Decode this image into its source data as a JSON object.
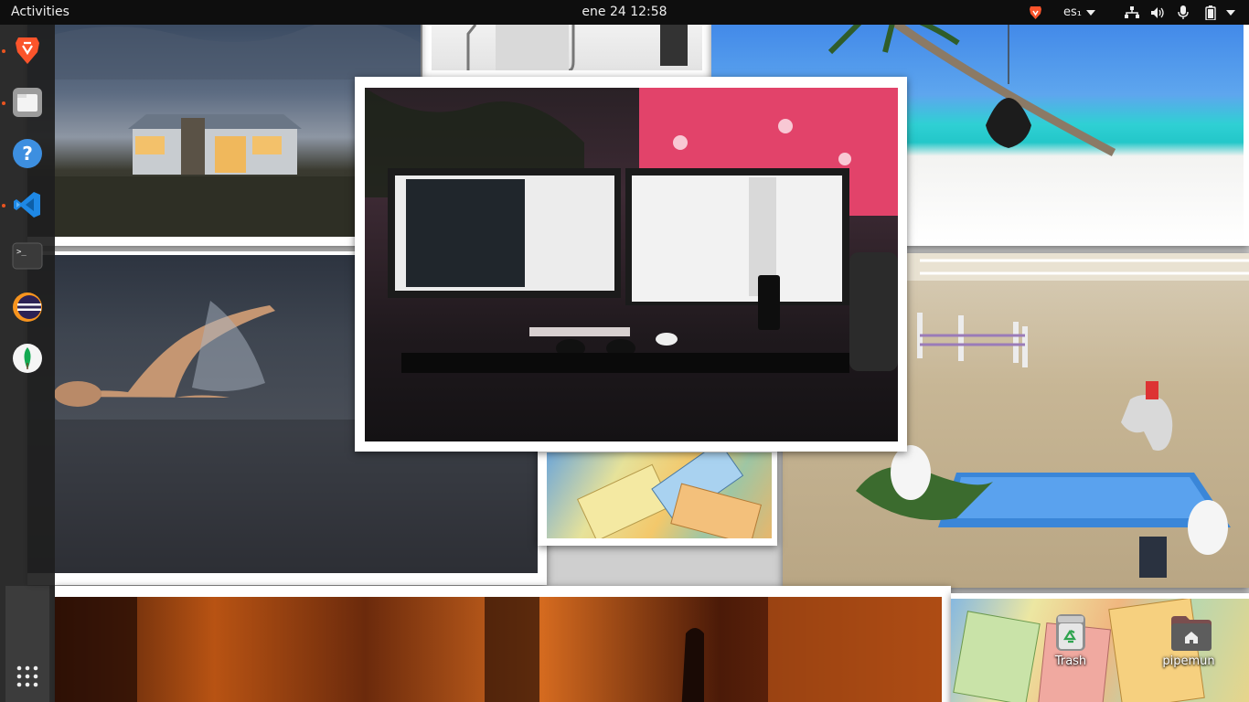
{
  "topbar": {
    "activities": "Activities",
    "clock": "ene 24  12:58",
    "keyboard_layout": "es₁",
    "tray_icons": [
      "brave-icon",
      "keyboard-layout-chevron",
      "network-icon",
      "volume-icon",
      "microphone-icon",
      "battery-icon",
      "system-menu-chevron"
    ]
  },
  "dock": {
    "items": [
      "brave-browser",
      "files",
      "help",
      "visual-studio-code",
      "terminal",
      "eclipse",
      "mongodb-compass"
    ],
    "running": [
      "brave-browser",
      "files",
      "visual-studio-code"
    ],
    "show_apps": "show-applications-grid"
  },
  "desktop": {
    "icons": [
      {
        "label": "Trash",
        "icon": "trash-icon"
      },
      {
        "label": "pipemun",
        "icon": "home-folder-icon"
      }
    ]
  },
  "wallpaper": {
    "photos": [
      "house-at-dusk",
      "swimmer",
      "statue",
      "beach-swing",
      "horse-show-jumping",
      "euro-banknotes",
      "desk-dual-monitors",
      "orange-street-scene",
      "euro-banknotes-2"
    ]
  },
  "colors": {
    "topbar": "#0e0e0e",
    "accent": "#e95420",
    "dock": "#1e1e1e"
  }
}
